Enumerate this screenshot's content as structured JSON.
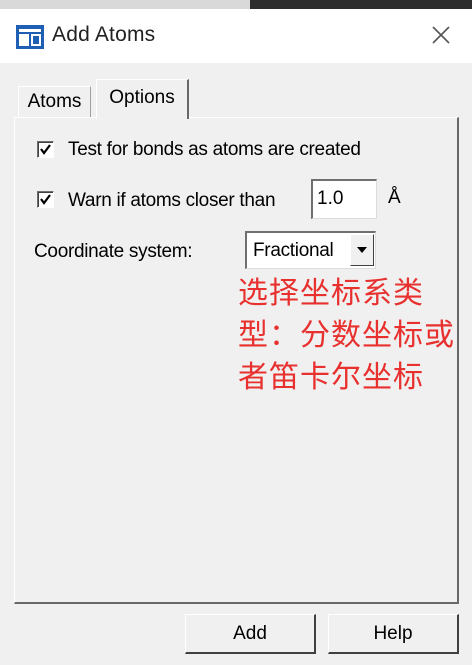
{
  "window": {
    "title": "Add Atoms",
    "icon": "app-window-icon",
    "close_icon": "close-icon"
  },
  "tabs": [
    {
      "label": "Atoms",
      "selected": false
    },
    {
      "label": "Options",
      "selected": true
    }
  ],
  "options": {
    "test_bonds": {
      "label": "Test for bonds as atoms are created",
      "checked": true
    },
    "warn_closer": {
      "label": "Warn if atoms closer than",
      "checked": true,
      "value": "1.0",
      "unit": "Å"
    },
    "coordinate_system": {
      "label": "Coordinate system:",
      "selected": "Fractional"
    }
  },
  "annotation": {
    "text": "选择坐标系类型：分数坐标或者笛卡尔坐标",
    "color": "#e8312f"
  },
  "buttons": {
    "add": "Add",
    "help": "Help"
  },
  "colors": {
    "accent_icon": "#1e5fb4",
    "annotation": "#e8312f"
  }
}
